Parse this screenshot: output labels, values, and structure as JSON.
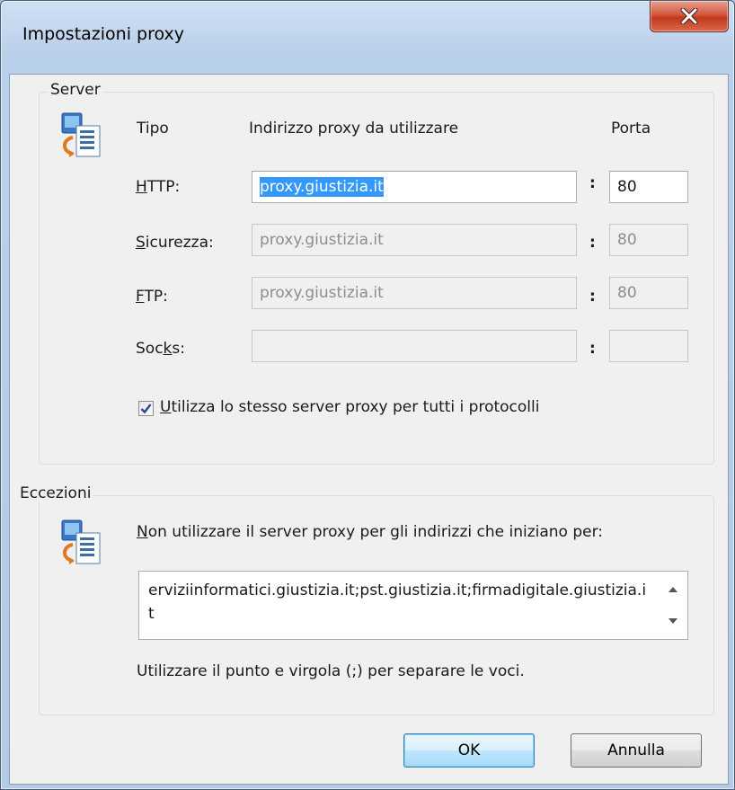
{
  "window": {
    "title": "Impostazioni proxy"
  },
  "server": {
    "group_label": "Server",
    "col_type": "Tipo",
    "col_address": "Indirizzo proxy da utilizzare",
    "col_port": "Porta",
    "rows": [
      {
        "label_pre": "",
        "label_ul": "H",
        "label_post": "TTP:",
        "address": "proxy.giustizia.it",
        "port": "80",
        "enabled": true,
        "selected": true
      },
      {
        "label_pre": "",
        "label_ul": "S",
        "label_post": "icurezza:",
        "address": "proxy.giustizia.it",
        "port": "80",
        "enabled": false
      },
      {
        "label_pre": "",
        "label_ul": "F",
        "label_post": "TP:",
        "address": "proxy.giustizia.it",
        "port": "80",
        "enabled": false
      },
      {
        "label_pre": "Soc",
        "label_ul": "k",
        "label_post": "s:",
        "address": "",
        "port": "",
        "enabled": false
      }
    ],
    "colon": ":",
    "same_proxy": {
      "checked": true,
      "label_ul": "U",
      "label_rest": "tilizza lo stesso server proxy per tutti i protocolli"
    }
  },
  "exceptions": {
    "group_label": "Eccezioni",
    "instruction_ul": "N",
    "instruction_rest": "on utilizzare il server proxy per gli indirizzi che iniziano per:",
    "value": "erviziinformatici.giustizia.it;pst.giustizia.it;firmadigitale.giustizia.it",
    "hint": "Utilizzare il punto e virgola (;) per separare le voci."
  },
  "buttons": {
    "ok": "OK",
    "cancel": "Annulla"
  },
  "icons": [
    "close-icon",
    "proxy-server-icon",
    "checkmark-icon",
    "scroll-up-arrow-icon",
    "scroll-down-arrow-icon"
  ]
}
